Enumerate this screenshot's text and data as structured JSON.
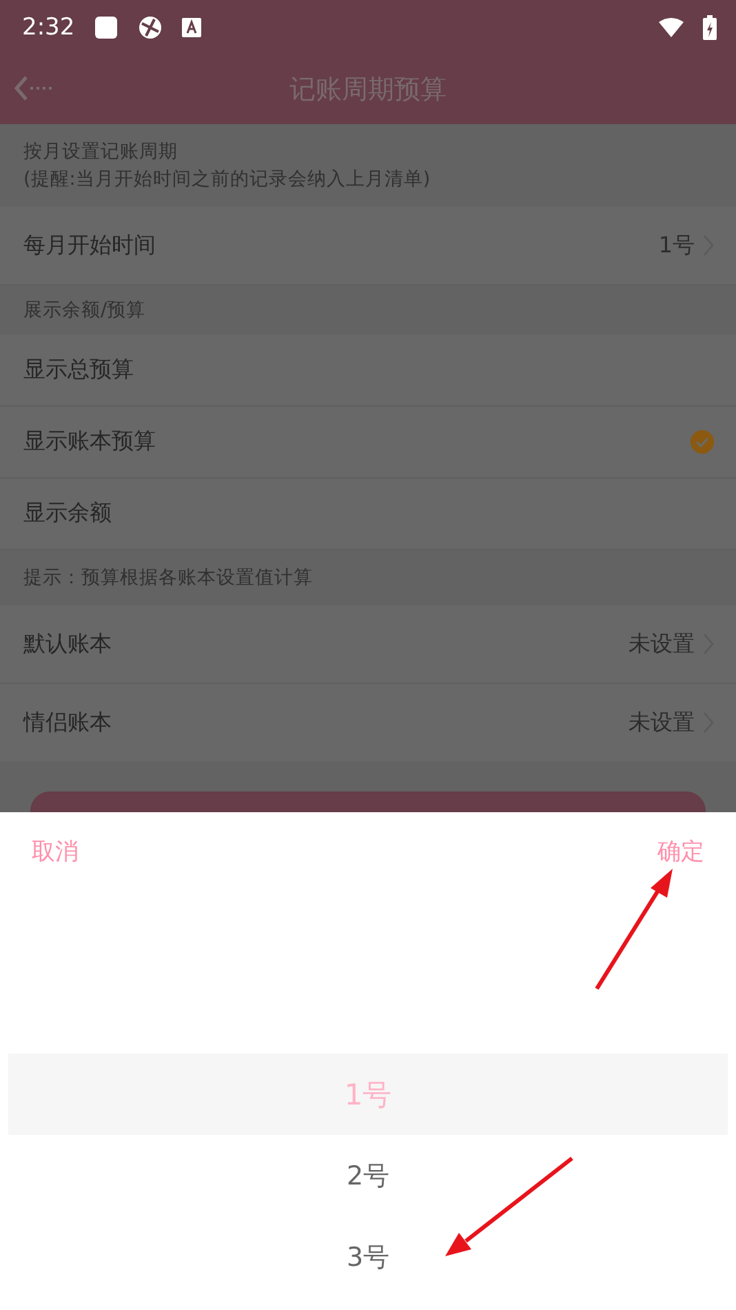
{
  "status_bar": {
    "time": "2:32"
  },
  "header": {
    "title": "记账周期预算"
  },
  "sections": [
    {
      "note": "按月设置记账周期\n(提醒:当月开始时间之前的记录会纳入上月清单)",
      "rows": [
        {
          "kind": "value",
          "label": "每月开始时间",
          "value": "1号"
        }
      ]
    },
    {
      "note": "展示余额/预算",
      "rows": [
        {
          "kind": "check",
          "label": "显示总预算",
          "checked": false
        },
        {
          "kind": "check",
          "label": "显示账本预算",
          "checked": true
        },
        {
          "kind": "check",
          "label": "显示余额",
          "checked": false
        }
      ]
    },
    {
      "note": "提示：预算根据各账本设置值计算",
      "rows": [
        {
          "kind": "value",
          "label": "默认账本",
          "value": "未设置"
        },
        {
          "kind": "value",
          "label": "情侣账本",
          "value": "未设置"
        }
      ]
    }
  ],
  "picker": {
    "cancel": "取消",
    "confirm": "确定",
    "options": [
      {
        "label": "1号",
        "selected": true
      },
      {
        "label": "2号",
        "selected": false
      },
      {
        "label": "3号",
        "selected": false
      }
    ]
  }
}
